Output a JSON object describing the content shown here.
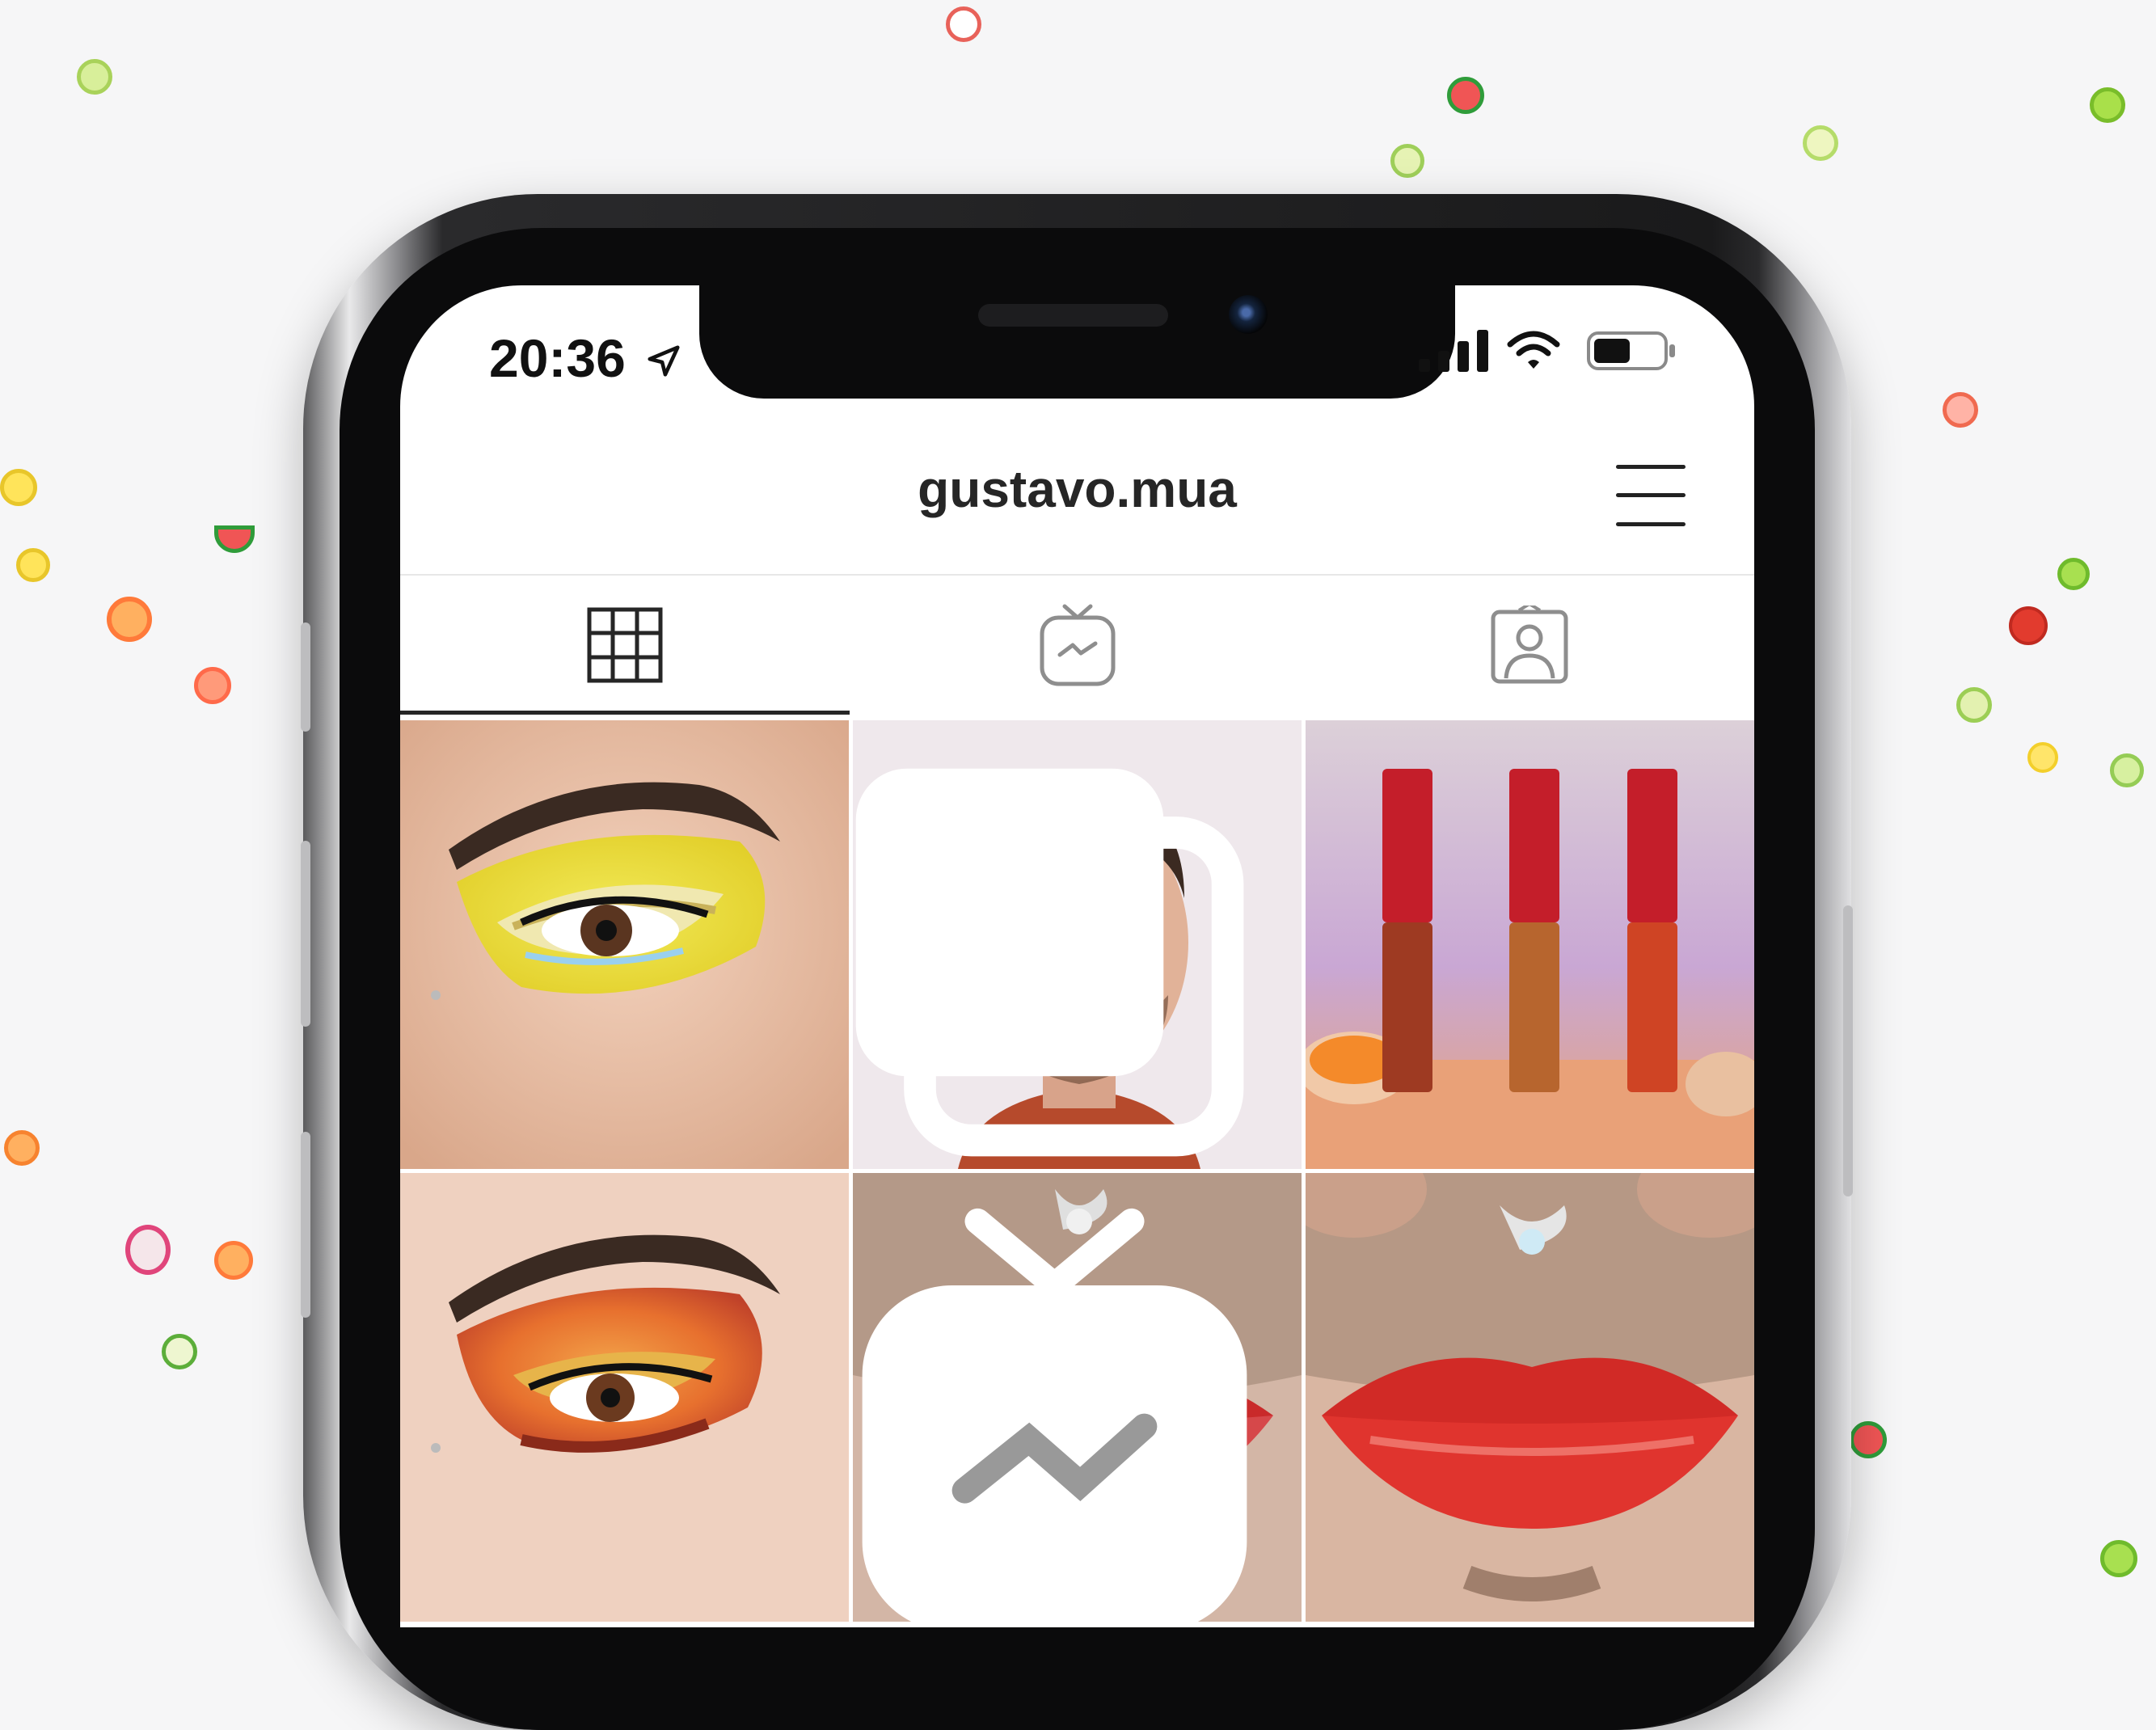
{
  "status_bar": {
    "time": "20:36",
    "icons": [
      "location-arrow-icon",
      "cellular-signal-icon",
      "wifi-icon",
      "battery-icon"
    ]
  },
  "profile": {
    "username": "gustavo.mua"
  },
  "tabs": [
    {
      "name": "grid",
      "icon": "grid-icon",
      "selected": true
    },
    {
      "name": "igtv",
      "icon": "igtv-icon",
      "selected": false
    },
    {
      "name": "tagged",
      "icon": "tagged-person-icon",
      "selected": false
    }
  ],
  "posts": [
    {
      "subject": "yellow eyeshadow eye look",
      "badge": null
    },
    {
      "subject": "portrait with gold lips",
      "badge": "carousel-icon"
    },
    {
      "subject": "three liquid lipstick tubes",
      "badge": null
    },
    {
      "subject": "orange eyeshadow eye look",
      "badge": null
    },
    {
      "subject": "lips with makeup brush",
      "badge": "igtv-icon"
    },
    {
      "subject": "red glossy lips",
      "badge": null
    }
  ],
  "colors": {
    "background": "#f6f6f7",
    "text": "#262626",
    "divider": "#e7e7e7"
  }
}
